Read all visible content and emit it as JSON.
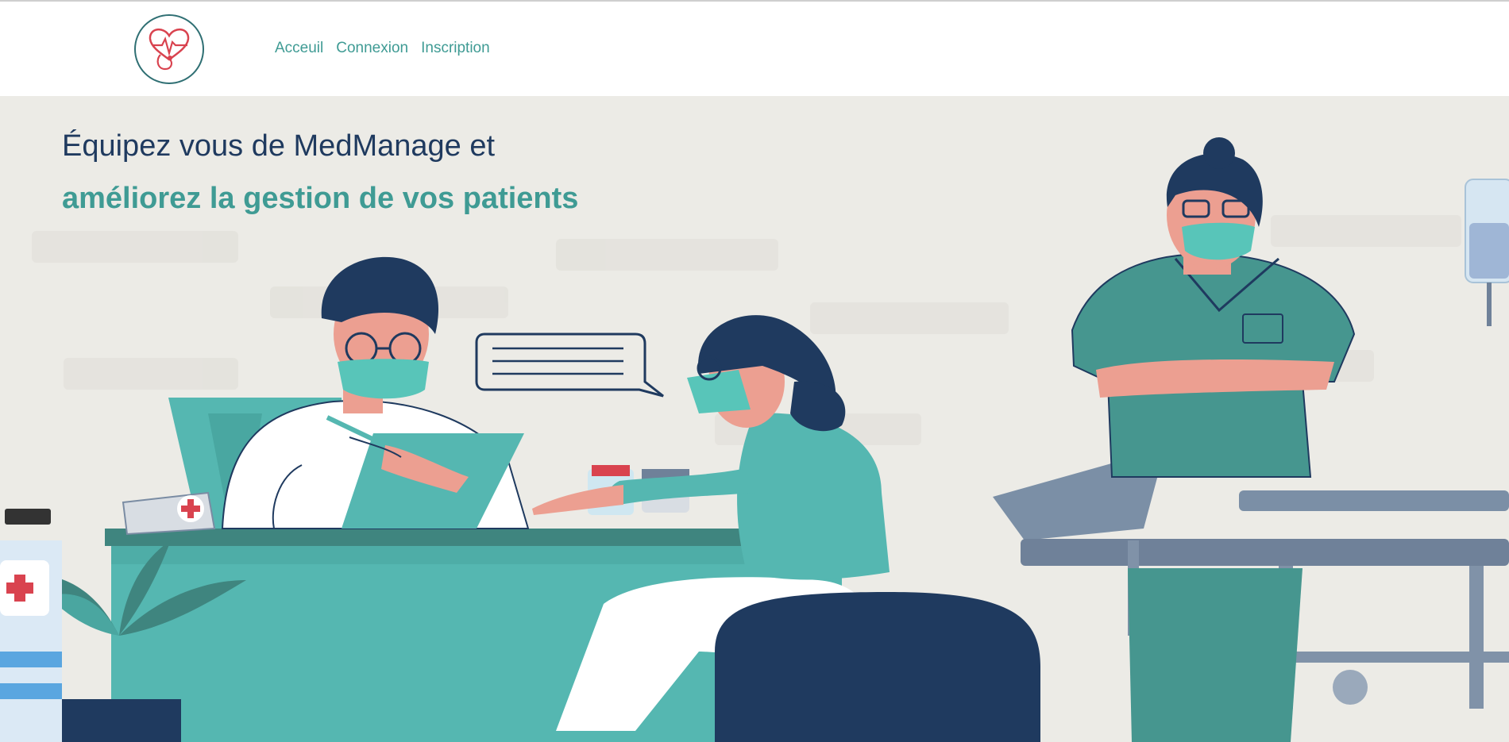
{
  "nav": {
    "logo_icon": "heart-stethoscope-icon",
    "links": [
      "Acceuil",
      "Connexion",
      "Inscription"
    ]
  },
  "hero": {
    "heading_line1": "Équipez vous de MedManage et",
    "heading_line2": "améliorez la gestion de vos patients",
    "illustration": "medical-consultation-illustration"
  },
  "colors": {
    "accent": "#3f9b94",
    "navy": "#1f3a5f",
    "teal": "#55b7b1",
    "scrubs": "#46968f",
    "skin": "#ec9f91",
    "background": "#ecebe6"
  }
}
